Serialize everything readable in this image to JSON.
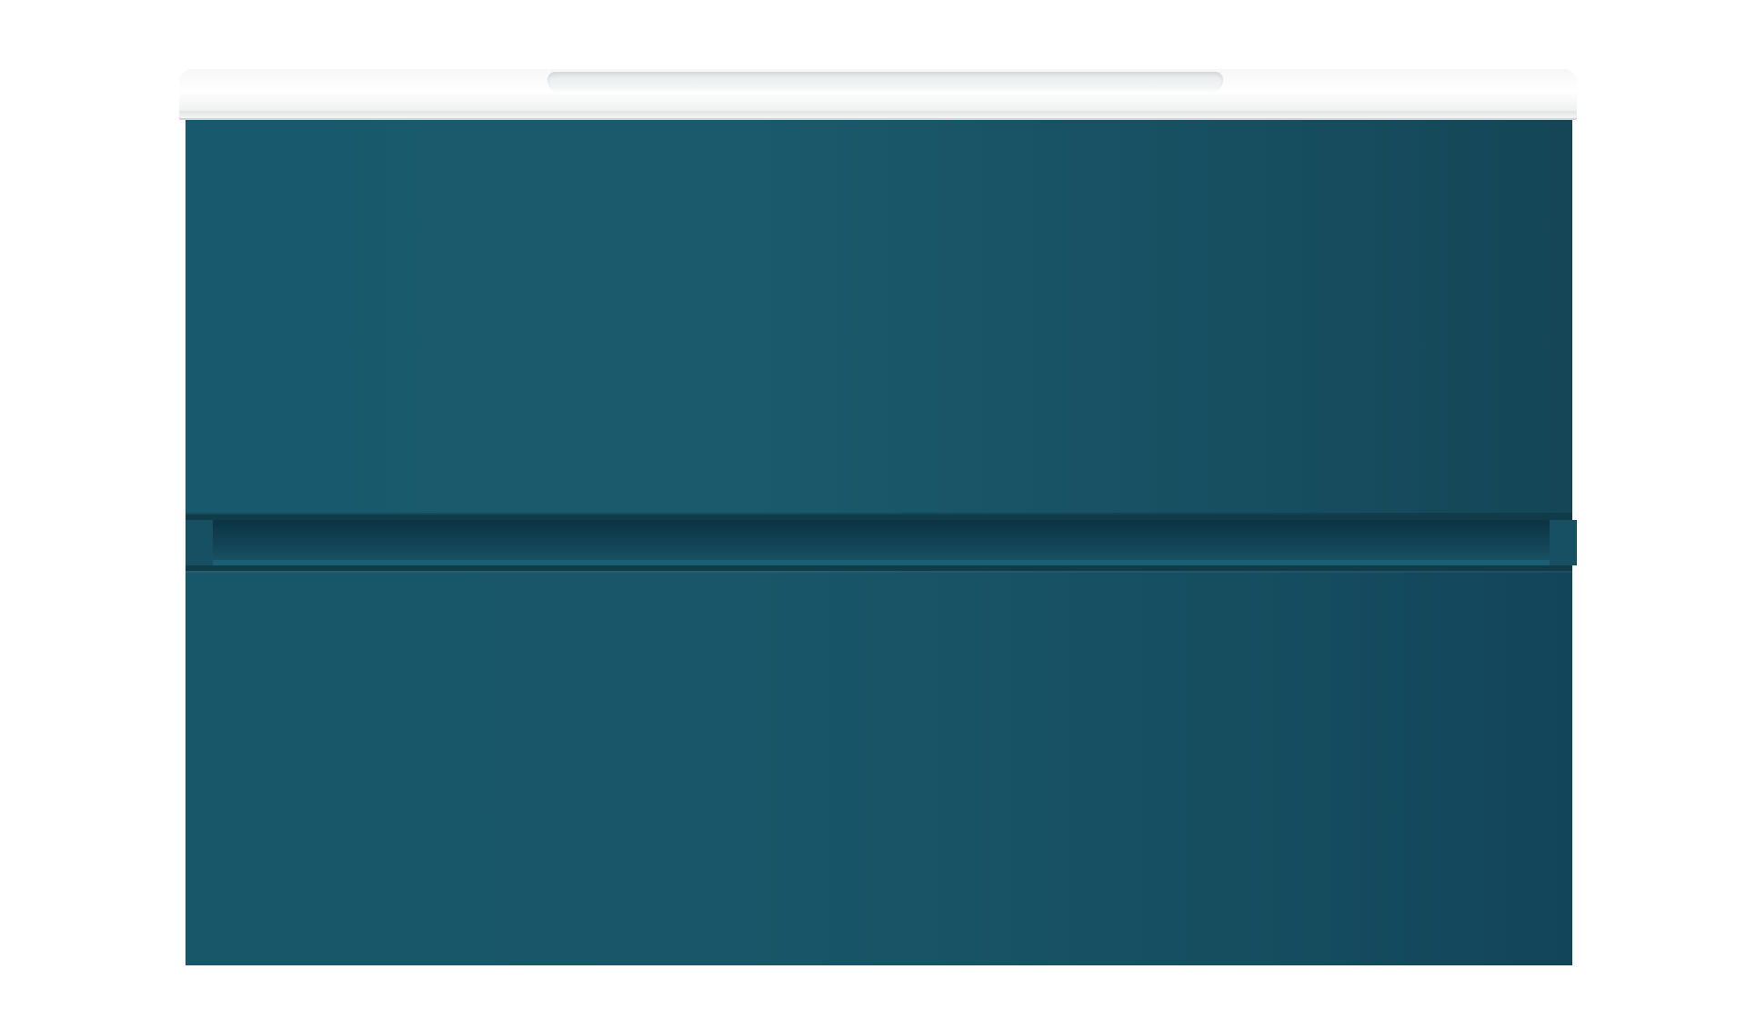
{
  "scene": {
    "subject": "bathroom-vanity",
    "colors": {
      "background": "#ffffff",
      "cabinet": "#1a5a6c",
      "cabinet_shadow": "#103c4a",
      "countertop": "#ffffff"
    },
    "drawer_count": 2
  }
}
